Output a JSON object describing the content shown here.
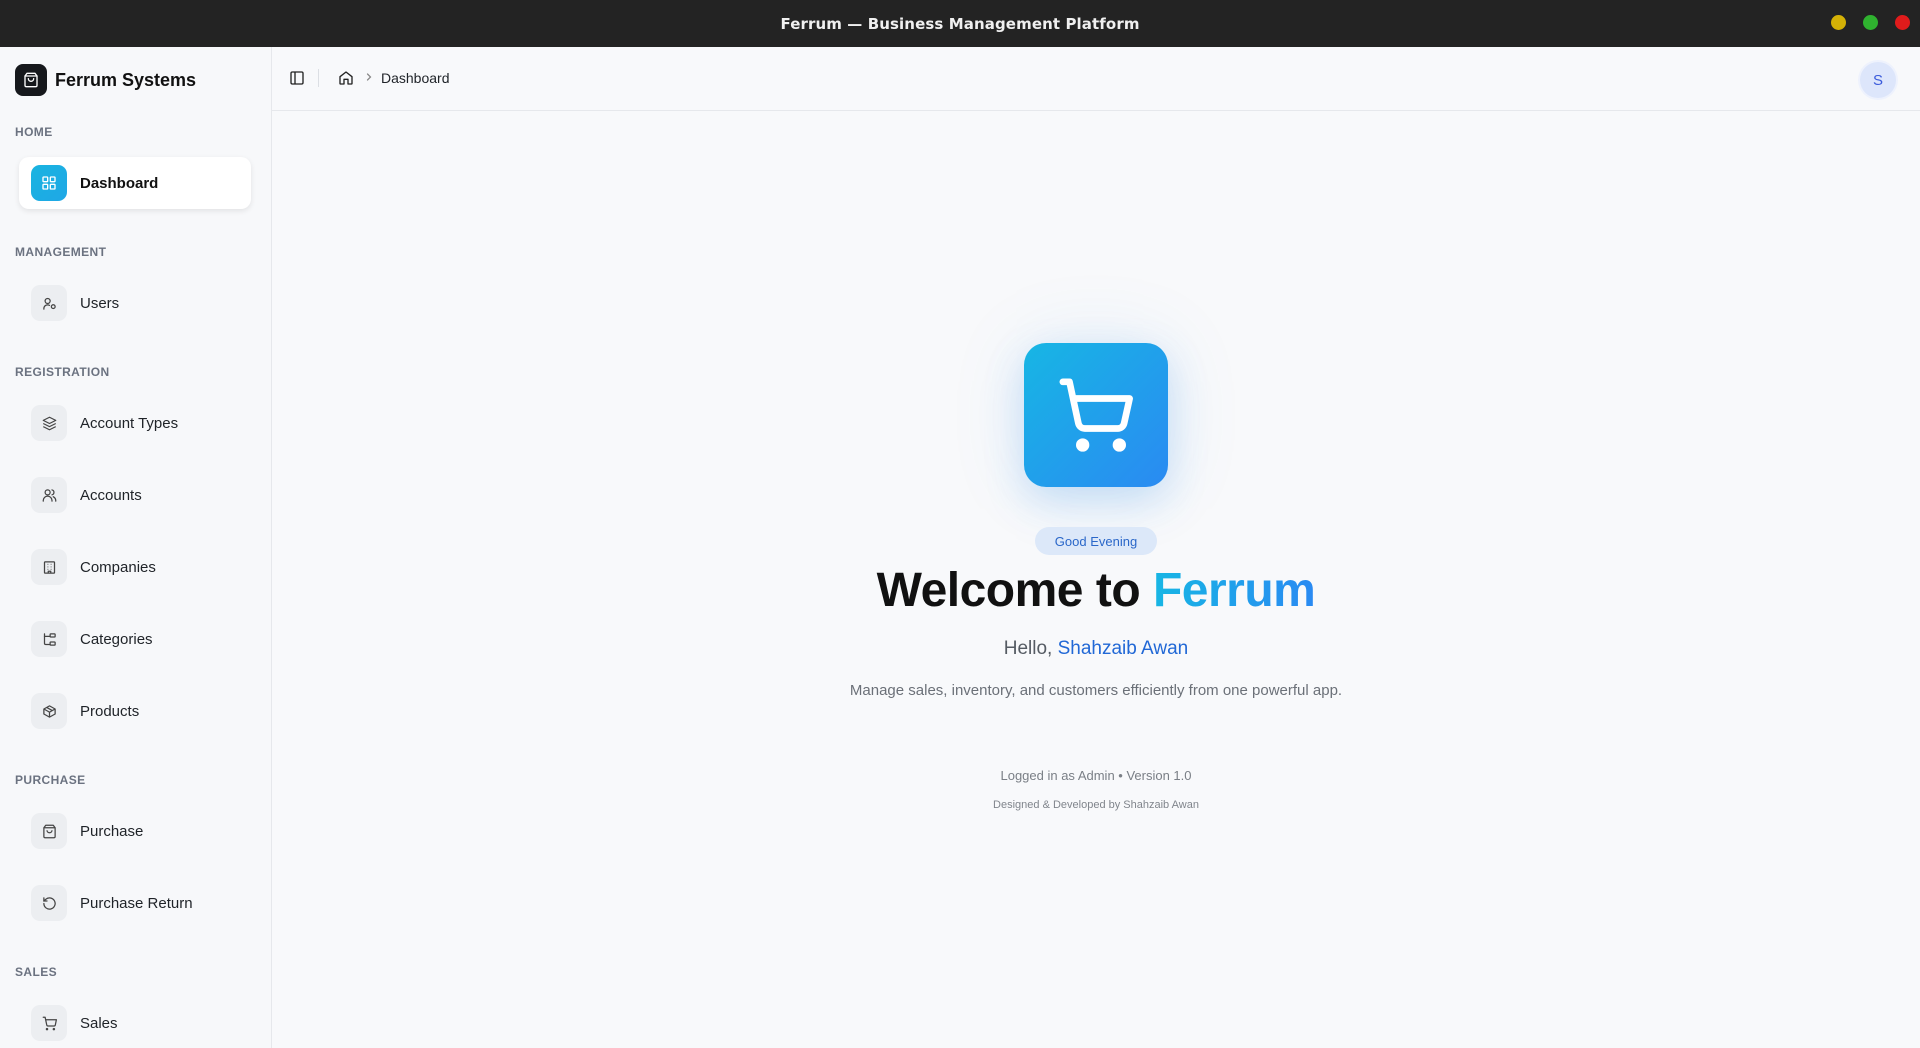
{
  "window": {
    "title": "Ferrum — Business Management Platform",
    "controls": {
      "minimize_color": "#d4b106",
      "maximize_color": "#2fb22f",
      "close_color": "#e01b1b"
    }
  },
  "brand": {
    "name": "Ferrum Systems"
  },
  "sidebar": {
    "sections": [
      {
        "label": "HOME",
        "items": [
          {
            "label": "Dashboard",
            "icon": "grid-icon",
            "active": true
          }
        ]
      },
      {
        "label": "MANAGEMENT",
        "items": [
          {
            "label": "Users",
            "icon": "user-cog-icon"
          }
        ]
      },
      {
        "label": "REGISTRATION",
        "items": [
          {
            "label": "Account Types",
            "icon": "layers-icon"
          },
          {
            "label": "Accounts",
            "icon": "users-icon"
          },
          {
            "label": "Companies",
            "icon": "building-icon"
          },
          {
            "label": "Categories",
            "icon": "hierarchy-icon"
          },
          {
            "label": "Products",
            "icon": "box-icon"
          }
        ]
      },
      {
        "label": "PURCHASE",
        "items": [
          {
            "label": "Purchase",
            "icon": "shopping-bag-icon"
          },
          {
            "label": "Purchase Return",
            "icon": "rotate-ccw-icon"
          }
        ]
      },
      {
        "label": "SALES",
        "items": [
          {
            "label": "Sales",
            "icon": "cart-icon"
          }
        ]
      }
    ]
  },
  "header": {
    "breadcrumb": {
      "current": "Dashboard"
    },
    "avatar_initial": "S"
  },
  "main": {
    "greeting": "Good Evening",
    "welcome_prefix": "Welcome to",
    "welcome_brand": "Ferrum",
    "hello_prefix": "Hello,",
    "user_name": "Shahzaib Awan",
    "tagline": "Manage sales, inventory, and customers efficiently from one powerful app.",
    "login_info": "Logged in as Admin • Version 1.0",
    "credit": "Designed & Developed by Shahzaib Awan"
  },
  "colors": {
    "accent_start": "#17b6e4",
    "accent_end": "#2a8af2",
    "link": "#2168d6"
  }
}
